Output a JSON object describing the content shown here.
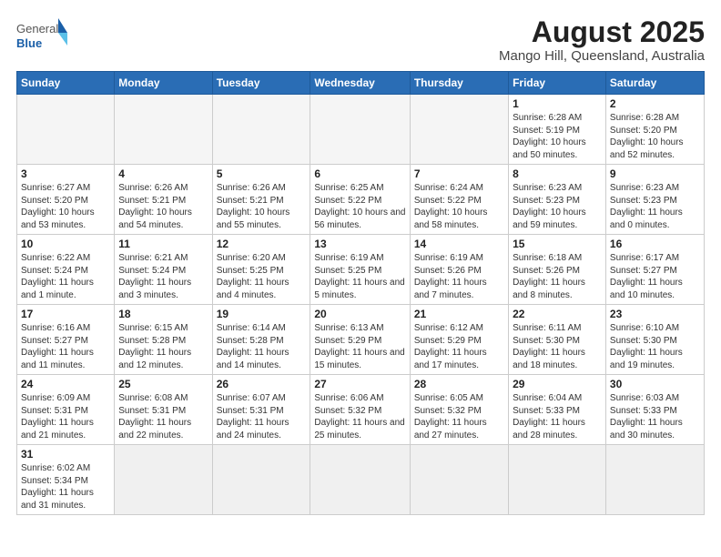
{
  "header": {
    "logo_general": "General",
    "logo_blue": "Blue",
    "title": "August 2025",
    "subtitle": "Mango Hill, Queensland, Australia"
  },
  "weekdays": [
    "Sunday",
    "Monday",
    "Tuesday",
    "Wednesday",
    "Thursday",
    "Friday",
    "Saturday"
  ],
  "weeks": [
    [
      {
        "day": "",
        "info": ""
      },
      {
        "day": "",
        "info": ""
      },
      {
        "day": "",
        "info": ""
      },
      {
        "day": "",
        "info": ""
      },
      {
        "day": "",
        "info": ""
      },
      {
        "day": "1",
        "info": "Sunrise: 6:28 AM\nSunset: 5:19 PM\nDaylight: 10 hours and 50 minutes."
      },
      {
        "day": "2",
        "info": "Sunrise: 6:28 AM\nSunset: 5:20 PM\nDaylight: 10 hours and 52 minutes."
      }
    ],
    [
      {
        "day": "3",
        "info": "Sunrise: 6:27 AM\nSunset: 5:20 PM\nDaylight: 10 hours and 53 minutes."
      },
      {
        "day": "4",
        "info": "Sunrise: 6:26 AM\nSunset: 5:21 PM\nDaylight: 10 hours and 54 minutes."
      },
      {
        "day": "5",
        "info": "Sunrise: 6:26 AM\nSunset: 5:21 PM\nDaylight: 10 hours and 55 minutes."
      },
      {
        "day": "6",
        "info": "Sunrise: 6:25 AM\nSunset: 5:22 PM\nDaylight: 10 hours and 56 minutes."
      },
      {
        "day": "7",
        "info": "Sunrise: 6:24 AM\nSunset: 5:22 PM\nDaylight: 10 hours and 58 minutes."
      },
      {
        "day": "8",
        "info": "Sunrise: 6:23 AM\nSunset: 5:23 PM\nDaylight: 10 hours and 59 minutes."
      },
      {
        "day": "9",
        "info": "Sunrise: 6:23 AM\nSunset: 5:23 PM\nDaylight: 11 hours and 0 minutes."
      }
    ],
    [
      {
        "day": "10",
        "info": "Sunrise: 6:22 AM\nSunset: 5:24 PM\nDaylight: 11 hours and 1 minute."
      },
      {
        "day": "11",
        "info": "Sunrise: 6:21 AM\nSunset: 5:24 PM\nDaylight: 11 hours and 3 minutes."
      },
      {
        "day": "12",
        "info": "Sunrise: 6:20 AM\nSunset: 5:25 PM\nDaylight: 11 hours and 4 minutes."
      },
      {
        "day": "13",
        "info": "Sunrise: 6:19 AM\nSunset: 5:25 PM\nDaylight: 11 hours and 5 minutes."
      },
      {
        "day": "14",
        "info": "Sunrise: 6:19 AM\nSunset: 5:26 PM\nDaylight: 11 hours and 7 minutes."
      },
      {
        "day": "15",
        "info": "Sunrise: 6:18 AM\nSunset: 5:26 PM\nDaylight: 11 hours and 8 minutes."
      },
      {
        "day": "16",
        "info": "Sunrise: 6:17 AM\nSunset: 5:27 PM\nDaylight: 11 hours and 10 minutes."
      }
    ],
    [
      {
        "day": "17",
        "info": "Sunrise: 6:16 AM\nSunset: 5:27 PM\nDaylight: 11 hours and 11 minutes."
      },
      {
        "day": "18",
        "info": "Sunrise: 6:15 AM\nSunset: 5:28 PM\nDaylight: 11 hours and 12 minutes."
      },
      {
        "day": "19",
        "info": "Sunrise: 6:14 AM\nSunset: 5:28 PM\nDaylight: 11 hours and 14 minutes."
      },
      {
        "day": "20",
        "info": "Sunrise: 6:13 AM\nSunset: 5:29 PM\nDaylight: 11 hours and 15 minutes."
      },
      {
        "day": "21",
        "info": "Sunrise: 6:12 AM\nSunset: 5:29 PM\nDaylight: 11 hours and 17 minutes."
      },
      {
        "day": "22",
        "info": "Sunrise: 6:11 AM\nSunset: 5:30 PM\nDaylight: 11 hours and 18 minutes."
      },
      {
        "day": "23",
        "info": "Sunrise: 6:10 AM\nSunset: 5:30 PM\nDaylight: 11 hours and 19 minutes."
      }
    ],
    [
      {
        "day": "24",
        "info": "Sunrise: 6:09 AM\nSunset: 5:31 PM\nDaylight: 11 hours and 21 minutes."
      },
      {
        "day": "25",
        "info": "Sunrise: 6:08 AM\nSunset: 5:31 PM\nDaylight: 11 hours and 22 minutes."
      },
      {
        "day": "26",
        "info": "Sunrise: 6:07 AM\nSunset: 5:31 PM\nDaylight: 11 hours and 24 minutes."
      },
      {
        "day": "27",
        "info": "Sunrise: 6:06 AM\nSunset: 5:32 PM\nDaylight: 11 hours and 25 minutes."
      },
      {
        "day": "28",
        "info": "Sunrise: 6:05 AM\nSunset: 5:32 PM\nDaylight: 11 hours and 27 minutes."
      },
      {
        "day": "29",
        "info": "Sunrise: 6:04 AM\nSunset: 5:33 PM\nDaylight: 11 hours and 28 minutes."
      },
      {
        "day": "30",
        "info": "Sunrise: 6:03 AM\nSunset: 5:33 PM\nDaylight: 11 hours and 30 minutes."
      }
    ],
    [
      {
        "day": "31",
        "info": "Sunrise: 6:02 AM\nSunset: 5:34 PM\nDaylight: 11 hours and 31 minutes."
      },
      {
        "day": "",
        "info": ""
      },
      {
        "day": "",
        "info": ""
      },
      {
        "day": "",
        "info": ""
      },
      {
        "day": "",
        "info": ""
      },
      {
        "day": "",
        "info": ""
      },
      {
        "day": "",
        "info": ""
      }
    ]
  ]
}
